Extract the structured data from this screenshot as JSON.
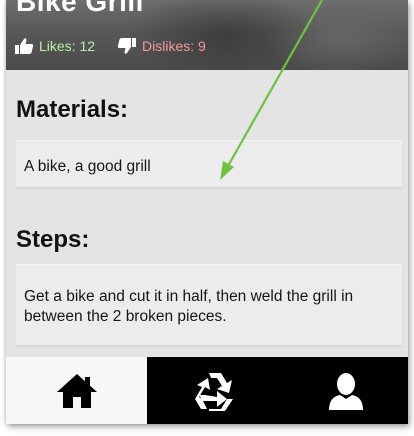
{
  "header": {
    "title": "Bike Grill",
    "likes_label": "Likes: 12",
    "dislikes_label": "Dislikes: 9",
    "likes_color": "#b9f0a6",
    "dislikes_color": "#f29a9a"
  },
  "materials": {
    "heading": "Materials:",
    "text": "A bike, a good grill"
  },
  "steps": {
    "heading": "Steps:",
    "text": "Get a bike and cut it in half, then weld the grill in between the 2 broken pieces."
  },
  "navbar": {
    "items": [
      {
        "icon": "home-icon",
        "active": true
      },
      {
        "icon": "recycle-icon",
        "active": false
      },
      {
        "icon": "user-icon",
        "active": false
      }
    ]
  },
  "annotation": {
    "arrow_color": "#6fc23f"
  }
}
